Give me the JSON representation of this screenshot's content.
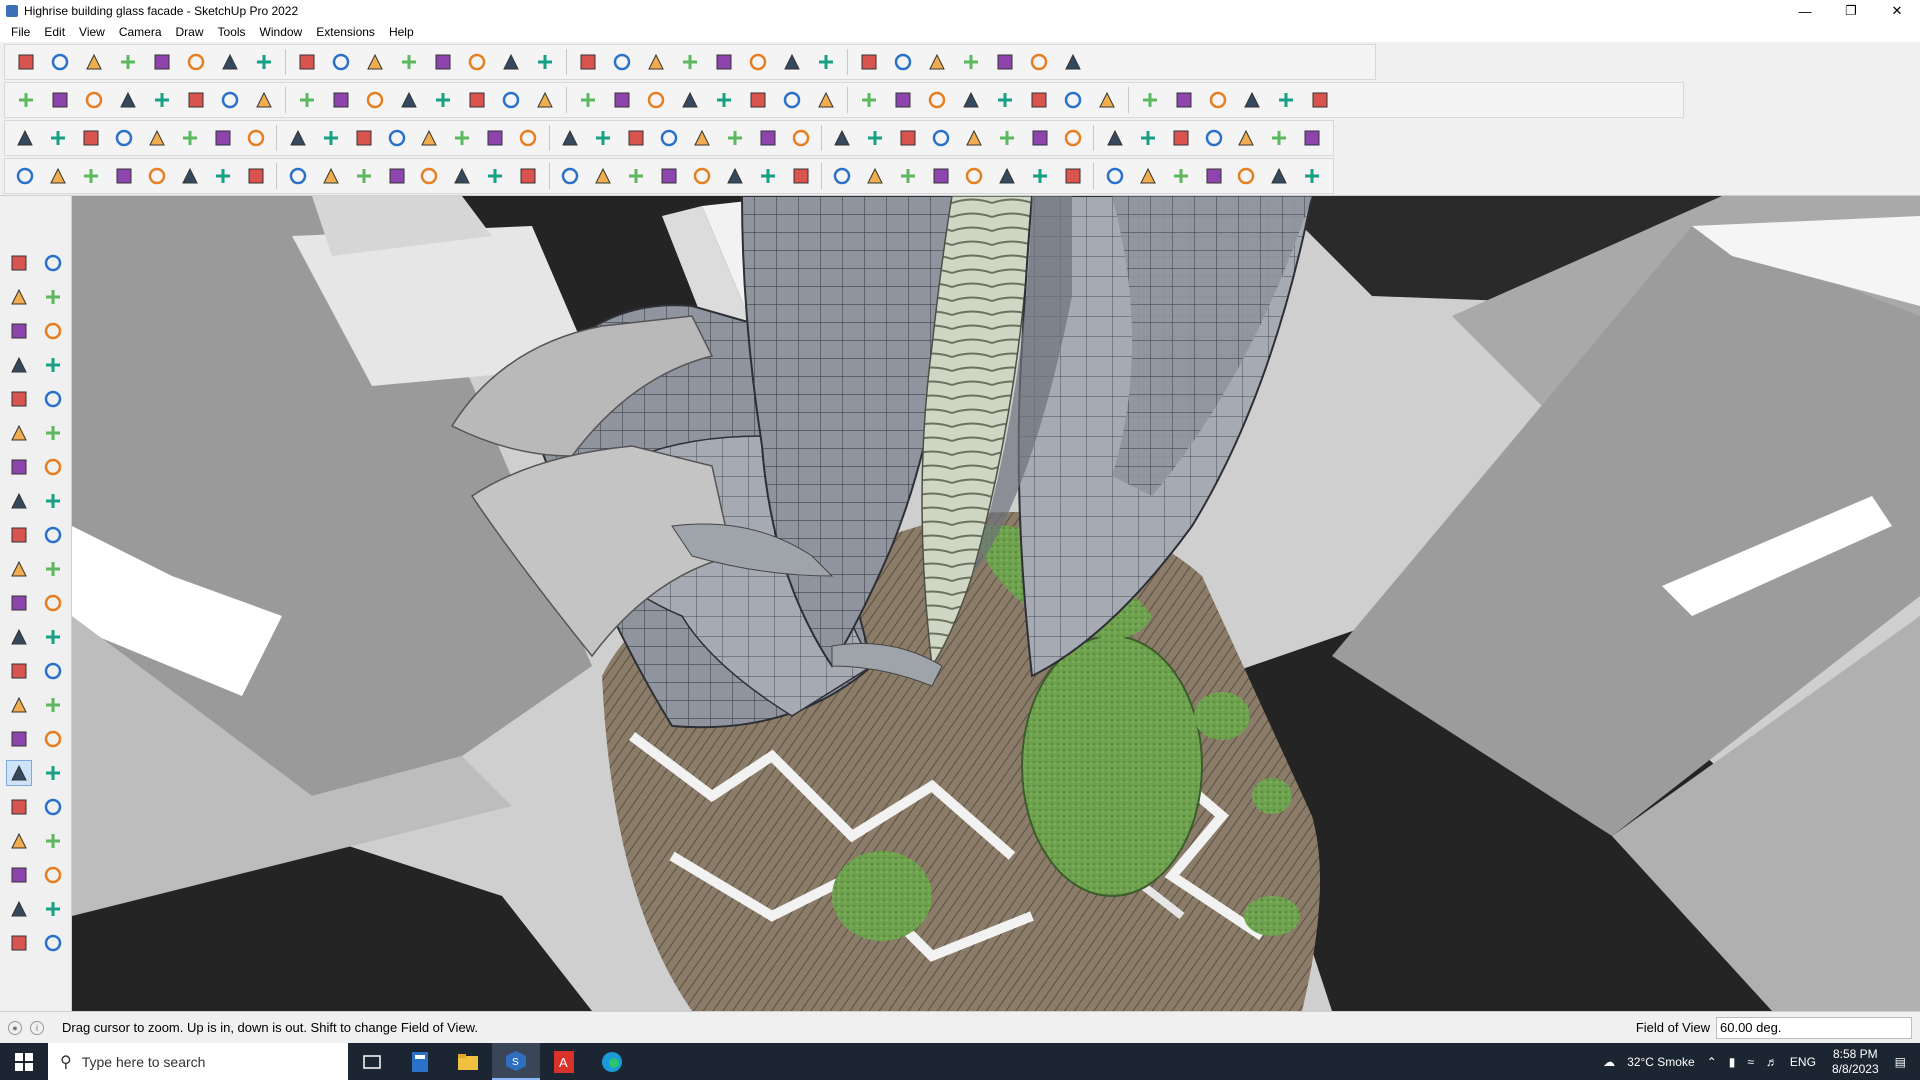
{
  "window": {
    "title": "Highrise building glass facade - SketchUp Pro 2022",
    "controls": [
      "minimize-icon",
      "restore-icon",
      "close-icon"
    ]
  },
  "menu": [
    "File",
    "Edit",
    "View",
    "Camera",
    "Draw",
    "Tools",
    "Window",
    "Extensions",
    "Help"
  ],
  "toolbars": {
    "row1_icons": [
      "zoom-search-icon",
      "select-arrow-icon",
      "eraser-icon",
      "pencil-icon",
      "freehand-icon",
      "rectangle-icon",
      "push-pull-icon",
      "follow-me-icon",
      "move-icon",
      "rotate-icon",
      "scale-icon",
      "tape-measure-icon",
      "text-icon",
      "paint-bucket-icon",
      "orbit-icon",
      "pan-icon",
      "zoom-icon",
      "zoom-extents-icon",
      "style-icon",
      "section-icon",
      "layers-icon",
      "components-icon",
      "account-icon",
      "tag-icon",
      "eye-icon",
      "axis-icon",
      "arrows-icon",
      "flip-icon",
      "undo-icon",
      "redo-icon",
      "extension-icon"
    ],
    "row2_icons": [
      "box-iso-icon",
      "box-front-icon",
      "box-top-icon",
      "axes-red-icon",
      "axes-blue-icon",
      "axes-green-icon",
      "axes-orange-icon",
      "axes-purple-icon",
      "bend-icon",
      "slash1-icon",
      "slash2-icon",
      "slash3-icon",
      "plane-icon",
      "plane-arrow-icon",
      "house-iso-icon",
      "house-front-icon",
      "house-outline-icon",
      "house-open-icon",
      "house-side-icon",
      "house-plain-icon",
      "font-icon",
      "hand-icon",
      "ruler-icon",
      "rect-icon",
      "circle-icon",
      "polygon-icon",
      "ellipse-icon",
      "arc-icon",
      "curve-icon",
      "spline-icon",
      "node-icon",
      "tool1-icon",
      "tool2-icon",
      "tool3-icon",
      "tool4-icon",
      "tool5-icon",
      "tool6-icon",
      "tool7-icon"
    ],
    "row3_icons": [
      "blue-box-icon",
      "blue-diamond-icon",
      "yellow-diamond-icon",
      "green-diamond-icon",
      "red-diamond-icon",
      "wire-icon",
      "orange-ring-icon",
      "red-square-icon",
      "red-grid-icon",
      "frame-icon",
      "wood-icon",
      "pipe-icon",
      "line-icon",
      "dot-line-icon",
      "cross-icon",
      "plus-icon",
      "tilted-cross-icon",
      "drop-icon",
      "cone-icon",
      "warning-icon",
      "orange-c-icon",
      "orange-pen-icon",
      "blue-ring-icon",
      "sparkle-icon",
      "bin-icon",
      "red-ring-icon",
      "green-frame-icon",
      "tool-a-icon",
      "tool-b-icon",
      "tool-c-icon",
      "tool-d-icon",
      "tool-e-icon",
      "tool-f-icon",
      "grid-yellow-icon",
      "grid-orange-icon",
      "grid-tan-icon",
      "cross-red-icon",
      "dots-icon",
      "qr-icon"
    ],
    "row4_icons": [
      "curve-edit-icon",
      "dots-line-icon",
      "car-icon",
      "scissor-icon",
      "gear-outline-icon",
      "sheet-icon",
      "spring-icon",
      "boxes-icon",
      "sphere-icon",
      "leaf-icon",
      "step1-icon",
      "step2-icon",
      "step3-icon",
      "curve-red-icon",
      "roll-icon",
      "wedge-icon",
      "comb-icon",
      "stair-icon",
      "hand-wave-icon",
      "fan-icon",
      "stack-icon",
      "blades-icon",
      "slope-icon",
      "fork-icon",
      "wing1-icon",
      "wing2-icon",
      "wing3-icon",
      "coil-icon",
      "slats-icon",
      "panel1-icon",
      "panel2-icon",
      "grid-dense-icon",
      "column-icon",
      "fence-icon",
      "disc-icon",
      "gear-dark-icon",
      "wave-icon",
      "bridge-icon",
      "cube-outline-icon"
    ]
  },
  "left_palette": [
    [
      "select-icon",
      "orbit-hand-icon"
    ],
    [
      "paint-bucket-icon",
      "eraser-icon"
    ],
    [
      "component-icon",
      "tape-icon"
    ],
    [
      "line-icon",
      "freehand-icon"
    ],
    [
      "rectangle-icon",
      "rotated-rect-icon"
    ],
    [
      "circle-icon",
      "polygon-icon"
    ],
    [
      "arc-icon",
      "two-point-arc-icon"
    ],
    [
      "pie-icon",
      "three-point-arc-icon"
    ],
    [
      "move-icon",
      "push-pull-icon"
    ],
    [
      "rotate-icon",
      "follow-me-icon"
    ],
    [
      "scale-icon",
      "offset-icon"
    ],
    [
      "tape-measure-icon",
      "dimension-icon"
    ],
    [
      "protractor-icon",
      "text-icon"
    ],
    [
      "axes-icon",
      "3d-text-icon"
    ],
    [
      "orbit-icon",
      "pan-icon"
    ],
    [
      "zoom-icon",
      "zoom-window-icon"
    ],
    [
      "zoom-extents-icon",
      "previous-view-icon"
    ],
    [
      "walk-icon",
      "look-around-icon"
    ],
    [
      "footprint-icon",
      "position-camera-icon"
    ],
    [
      "section-plane-icon",
      "section-display-icon"
    ],
    [
      "section-fill-icon",
      "section-cuts-icon"
    ]
  ],
  "status": {
    "message": "Drag cursor to zoom.  Up is in, down is out. Shift to change Field of View.",
    "vcb_label": "Field of View",
    "vcb_value": "60.00 deg."
  },
  "taskbar": {
    "search_placeholder": "Type here to search",
    "weather": "32°C  Smoke",
    "language": "ENG",
    "time": "8:58 PM",
    "date": "8/8/2023"
  },
  "colors": {
    "taskbar_bg": "#1c2532",
    "viewport_bg": "#c9c9c9",
    "grass": "#6ea24f",
    "paving": "#8a7c68",
    "glass": "#8f949e"
  }
}
